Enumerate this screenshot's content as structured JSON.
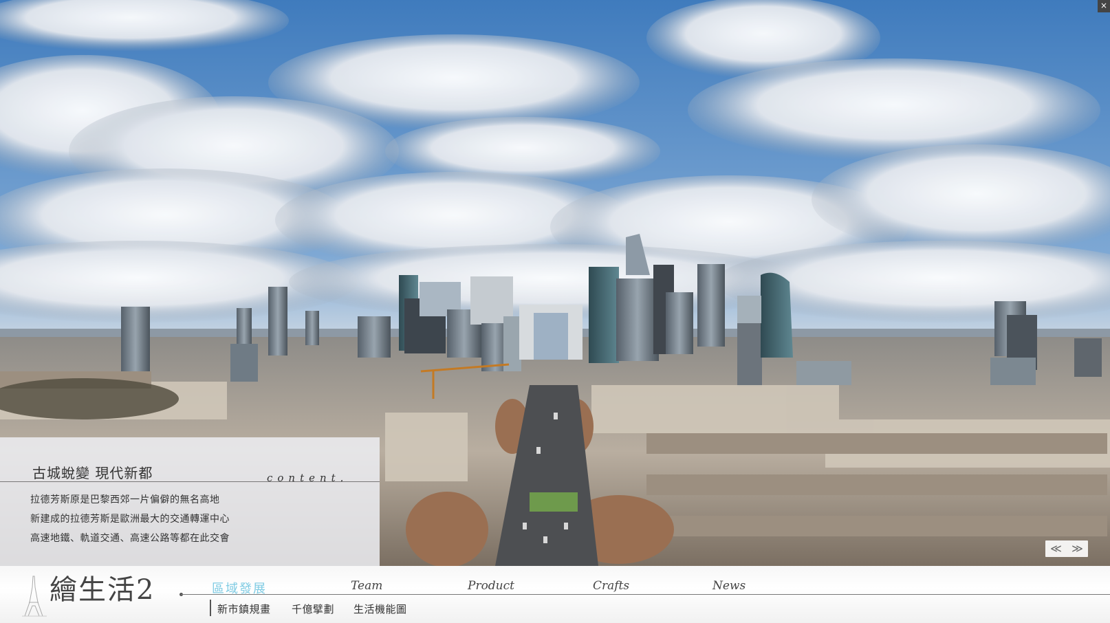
{
  "window": {
    "close_label": "×"
  },
  "content_panel": {
    "title": "古城蛻變 現代新都",
    "label": "content.",
    "lines": [
      "拉德芳斯原是巴黎西郊一片偏僻的無名高地",
      "新建成的拉德芳斯是歐洲最大的交通轉運中心",
      "高速地鐵、軌道交通、高速公路等都在此交會"
    ]
  },
  "slider": {
    "prev_label": "≪",
    "next_label": "≫"
  },
  "brand": {
    "logo_text": "繪生活2"
  },
  "nav": {
    "items": [
      {
        "label": "區域發展",
        "active": true
      },
      {
        "label": "Team"
      },
      {
        "label": "Product"
      },
      {
        "label": "Crafts"
      },
      {
        "label": "News"
      }
    ],
    "subnav": [
      "新市鎮規畫",
      "千億擘劃",
      "生活機能圖"
    ]
  },
  "colors": {
    "accent": "#7fcbe3",
    "sky": "#4f86c1",
    "text": "#333333"
  }
}
